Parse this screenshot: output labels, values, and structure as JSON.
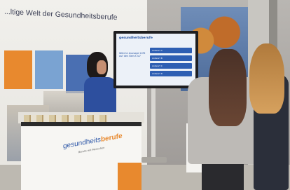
{
  "wall": {
    "slogan": "...ltige Welt der Gesundheitsberufe"
  },
  "screen": {
    "logo": "gesundheitsberufe",
    "question": "Welche Aussage trifft auf den Beruf zu?",
    "answers": [
      "Antwort A",
      "Antwort B",
      "Antwort C",
      "Antwort D"
    ]
  },
  "counter": {
    "logo_main": "gesundheits",
    "logo_accent": "berufe",
    "tagline": "Berufe mit Menschen"
  }
}
